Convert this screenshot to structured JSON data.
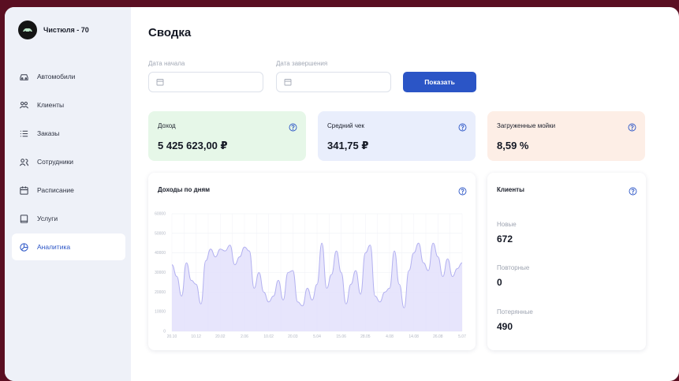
{
  "brand": {
    "name": "Чистюля - 70"
  },
  "sidebar": {
    "items": [
      {
        "label": "Автомобили",
        "icon": "car-icon"
      },
      {
        "label": "Клиенты",
        "icon": "users-icon"
      },
      {
        "label": "Заказы",
        "icon": "list-icon"
      },
      {
        "label": "Сотрудники",
        "icon": "employees-icon"
      },
      {
        "label": "Расписание",
        "icon": "calendar-icon"
      },
      {
        "label": "Услуги",
        "icon": "book-icon"
      },
      {
        "label": "Аналитика",
        "icon": "analytics-icon",
        "active": true
      }
    ]
  },
  "main": {
    "title": "Сводка",
    "filters": {
      "start_label": "Дата начала",
      "end_label": "Дата завершения",
      "start_value": "",
      "end_value": "",
      "show_button": "Показать"
    },
    "stats": [
      {
        "label": "Доход",
        "value": "5 425 623,00 ₽",
        "bg": "#e6f7e8"
      },
      {
        "label": "Средний чек",
        "value": "341,75 ₽",
        "bg": "#e9eefc"
      },
      {
        "label": "Загруженные мойки",
        "value": "8,59 %",
        "bg": "#fdeee6"
      }
    ],
    "clients": {
      "title": "Клиенты",
      "rows": [
        {
          "label": "Новые",
          "value": "672"
        },
        {
          "label": "Повторные",
          "value": "0"
        },
        {
          "label": "Потерянные",
          "value": "490"
        }
      ]
    }
  },
  "colors": {
    "accent": "#2b55c6",
    "chart_line": "#b3b1f0",
    "chart_fill": "#e3e1fb"
  },
  "chart_data": {
    "type": "area",
    "title": "Доходы по дням",
    "ylim": [
      0,
      60000
    ],
    "yticks": [
      "0",
      "10000",
      "20000",
      "30000",
      "40000",
      "50000",
      "60000"
    ],
    "xticks": [
      "20.10",
      "10.12",
      "20.02",
      "2.06",
      "10.02",
      "20.03",
      "5.04",
      "15.06",
      "28.05",
      "4.08",
      "14.08",
      "26.08",
      "5.07"
    ],
    "grid": true,
    "values": [
      34000,
      28000,
      18000,
      35000,
      26000,
      24000,
      14000,
      36000,
      42000,
      38000,
      42000,
      41000,
      44000,
      34000,
      38000,
      43000,
      41000,
      22000,
      30000,
      20000,
      15000,
      18000,
      26000,
      16000,
      30000,
      31000,
      15000,
      13000,
      22000,
      16000,
      24000,
      45000,
      22000,
      29000,
      41000,
      30000,
      14000,
      24000,
      31000,
      19000,
      40000,
      44000,
      18000,
      15000,
      20000,
      22000,
      41000,
      24000,
      12000,
      31000,
      40000,
      45000,
      35000,
      31000,
      45000,
      38000,
      28000,
      37000,
      28000,
      32000,
      35000
    ]
  }
}
